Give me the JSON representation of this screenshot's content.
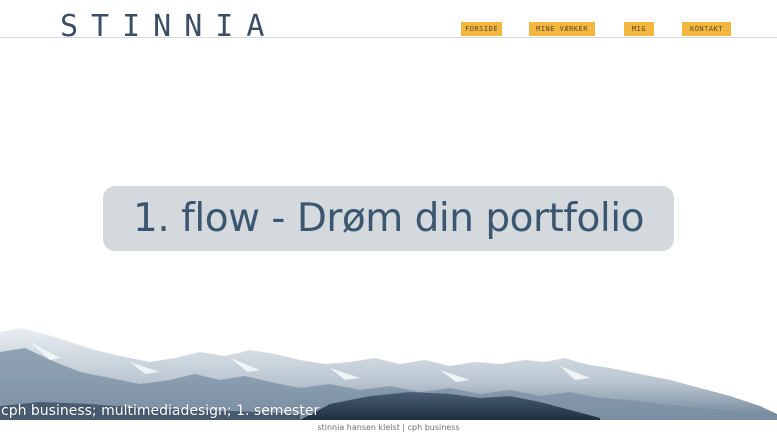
{
  "header": {
    "logo": "STINNIA",
    "nav": [
      "FORSIDE",
      "MINE VÆRKER",
      "MIG",
      "KONTAKT"
    ]
  },
  "main": {
    "title": "1. flow - Drøm din portfolio",
    "subtitle": "cph business; multimediadesign; 1. semester"
  },
  "footer": {
    "text": "stinnia hansen kleist | cph business"
  },
  "colors": {
    "accent": "#f3b63f",
    "logo": "#3b4e66",
    "title_text": "#3b5670",
    "title_bg": "#d3d9dc"
  }
}
